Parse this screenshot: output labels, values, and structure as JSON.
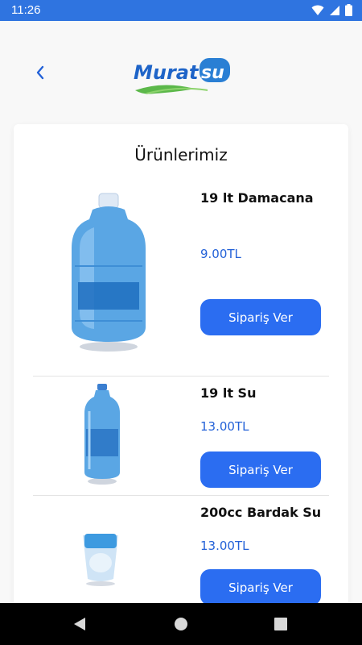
{
  "status_bar": {
    "time": "11:26"
  },
  "header": {
    "logo_text": "Muratsu"
  },
  "card": {
    "title": "Ürünlerimiz",
    "products": [
      {
        "name": "19 lt Damacana",
        "price": "9.00TL",
        "button_label": "Sipariş Ver"
      },
      {
        "name": "19 lt Su",
        "price": "13.00TL",
        "button_label": "Sipariş Ver"
      },
      {
        "name": "200cc Bardak Su",
        "price": "13.00TL",
        "button_label": "Sipariş Ver"
      }
    ]
  },
  "colors": {
    "accent": "#2b6df1",
    "price": "#2462d8",
    "status_bar": "#2f74e0"
  }
}
